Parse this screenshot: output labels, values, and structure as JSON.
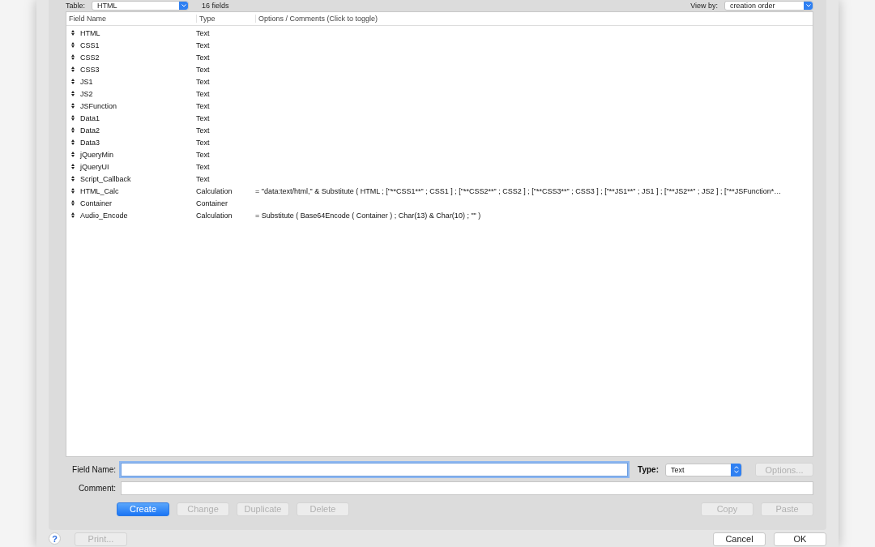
{
  "header": {
    "table_label": "Table:",
    "table_value": "HTML",
    "field_count": "16 fields",
    "view_label": "View by:",
    "view_value": "creation order"
  },
  "columns": [
    "Field Name",
    "Type",
    "Options / Comments   (Click to toggle)"
  ],
  "rows": [
    {
      "name": "HTML",
      "type": "Text",
      "options": ""
    },
    {
      "name": "CSS1",
      "type": "Text",
      "options": ""
    },
    {
      "name": "CSS2",
      "type": "Text",
      "options": ""
    },
    {
      "name": "CSS3",
      "type": "Text",
      "options": ""
    },
    {
      "name": "JS1",
      "type": "Text",
      "options": ""
    },
    {
      "name": "JS2",
      "type": "Text",
      "options": ""
    },
    {
      "name": "JSFunction",
      "type": "Text",
      "options": ""
    },
    {
      "name": "Data1",
      "type": "Text",
      "options": ""
    },
    {
      "name": "Data2",
      "type": "Text",
      "options": ""
    },
    {
      "name": "Data3",
      "type": "Text",
      "options": ""
    },
    {
      "name": "jQueryMin",
      "type": "Text",
      "options": ""
    },
    {
      "name": "jQueryUI",
      "type": "Text",
      "options": ""
    },
    {
      "name": "Script_Callback",
      "type": "Text",
      "options": ""
    },
    {
      "name": "HTML_Calc",
      "type": "Calculation",
      "options": "= \"data:text/html,\"  & Substitute (   HTML ; [\"**CSS1**\" ; CSS1 ] ;  [\"**CSS2**\" ; CSS2 ] ;  [\"**CSS3**\" ; CSS3 ] ;   [\"**JS1**\" ; JS1 ] ;  [\"**JS2**\" ; JS2 ] ;  [\"**JSFunction*…"
    },
    {
      "name": "Container",
      "type": "Container",
      "options": ""
    },
    {
      "name": "Audio_Encode",
      "type": "Calculation",
      "options": "= Substitute ( Base64Encode ( Container ) ; Char(13) & Char(10) ; \"\" )"
    }
  ],
  "form": {
    "field_name_label": "Field Name:",
    "field_name_focused": true,
    "type_label": "Type:",
    "type_value": "Text",
    "comment_label": "Comment:"
  },
  "options_button": {
    "label": "Options...",
    "disabled": true,
    "default": false
  },
  "action_buttons": [
    {
      "label": "Create",
      "disabled": false,
      "default": true
    },
    {
      "label": "Change",
      "disabled": true,
      "default": false
    },
    {
      "label": "Duplicate",
      "disabled": true,
      "default": false
    },
    {
      "label": "Delete",
      "disabled": true,
      "default": false
    }
  ],
  "clipboard_buttons": [
    {
      "label": "Copy",
      "disabled": true,
      "default": false
    },
    {
      "label": "Paste",
      "disabled": true,
      "default": false
    }
  ],
  "footer": {
    "help": "?",
    "print": {
      "label": "Print...",
      "disabled": true,
      "default": false
    },
    "buttons": [
      {
        "label": "Cancel",
        "disabled": false,
        "default": false
      },
      {
        "label": "OK",
        "disabled": false,
        "default": false
      }
    ]
  }
}
